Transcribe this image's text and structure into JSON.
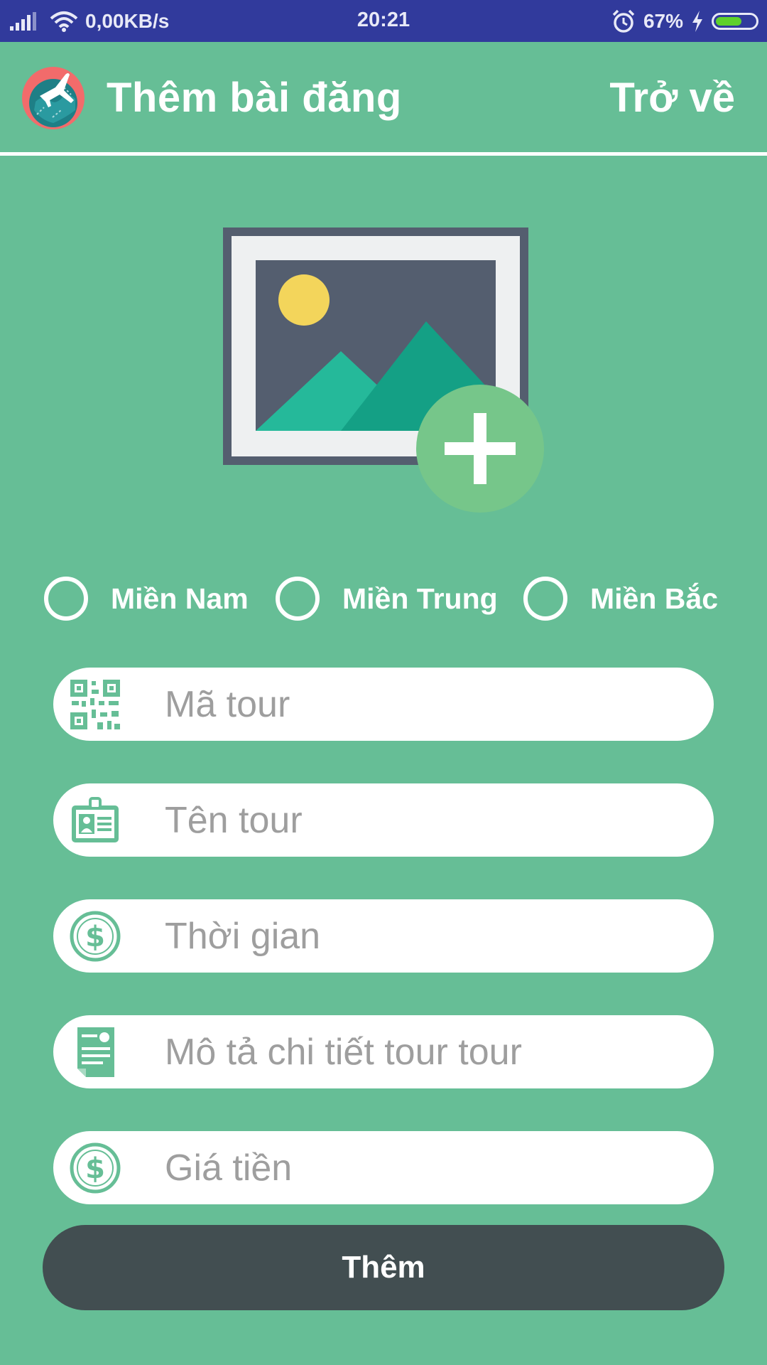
{
  "status_bar": {
    "network_speed": "0,00KB/s",
    "time": "20:21",
    "battery_percent_label": "67%",
    "battery_level": 0.67,
    "icons": [
      "signal-icon",
      "wifi-icon",
      "alarm-icon",
      "charging-icon",
      "battery-icon"
    ]
  },
  "header": {
    "title": "Thêm bài đăng",
    "back_label": "Trở về",
    "logo_icon": "globe-plane-logo"
  },
  "image_picker": {
    "icon": "image-add-icon"
  },
  "region": {
    "options": [
      {
        "label": "Miền Nam",
        "selected": false
      },
      {
        "label": "Miền Trung",
        "selected": false
      },
      {
        "label": "Miền Bắc",
        "selected": false
      }
    ]
  },
  "form": {
    "fields": [
      {
        "icon": "qr-code-icon",
        "placeholder": "Mã tour",
        "value": ""
      },
      {
        "icon": "id-card-icon",
        "placeholder": "Tên tour",
        "value": ""
      },
      {
        "icon": "dollar-icon",
        "placeholder": "Thời gian",
        "value": ""
      },
      {
        "icon": "document-icon",
        "placeholder": "Mô tả chi tiết tour tour",
        "value": ""
      },
      {
        "icon": "dollar-icon",
        "placeholder": "Giá tiền",
        "value": ""
      }
    ],
    "submit_label": "Thêm"
  },
  "colors": {
    "background": "#66BE96",
    "status_bar": "#313A9C",
    "button": "#424E51",
    "accent_green": "#78C68A"
  }
}
